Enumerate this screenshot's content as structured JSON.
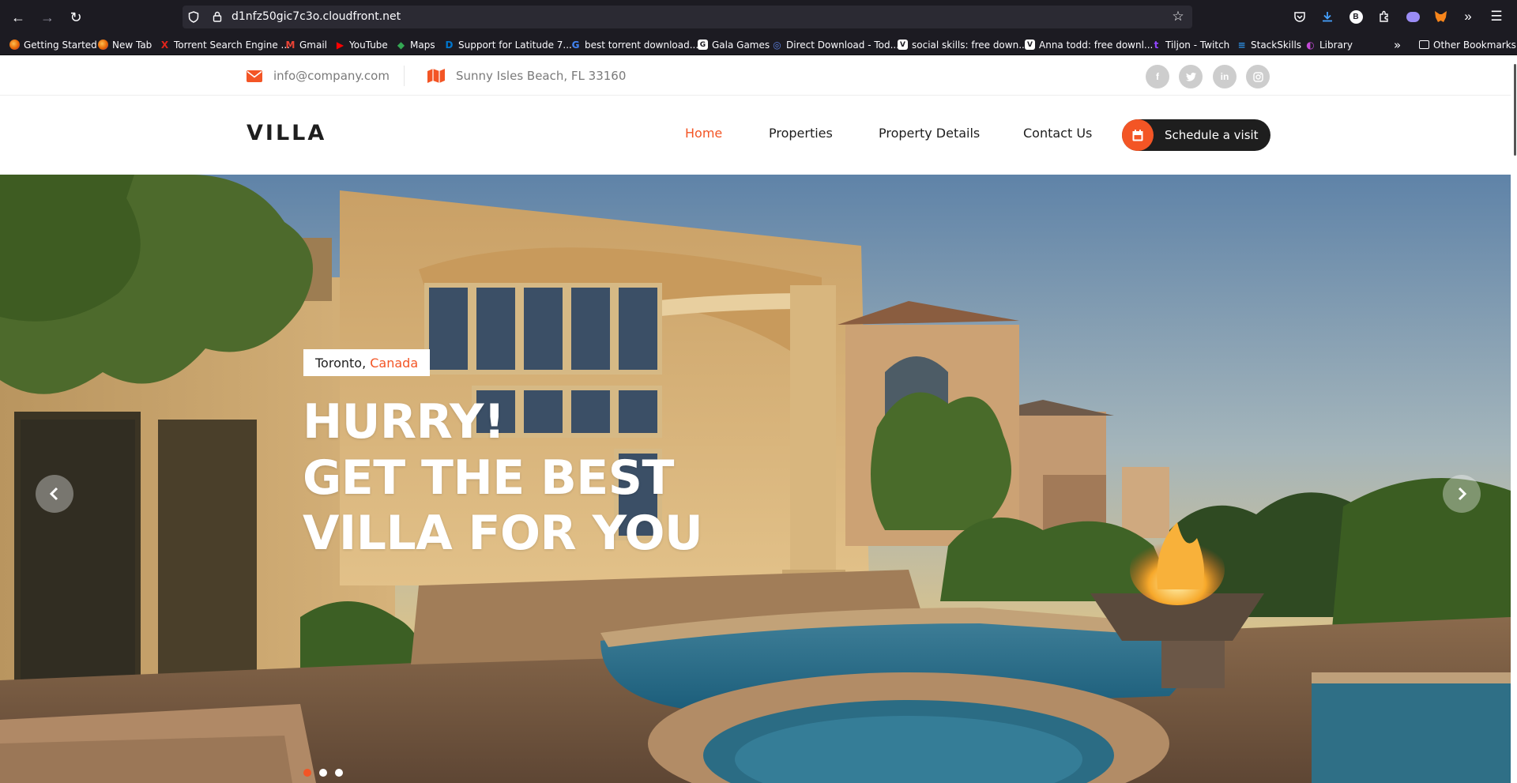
{
  "browser": {
    "url": "d1nfz50gic7c3o.cloudfront.net",
    "bookmarks": [
      {
        "label": "Getting Started",
        "icon": "firefox-icon",
        "color": "#e66000"
      },
      {
        "label": "New Tab",
        "icon": "firefox-icon",
        "color": "#e66000"
      },
      {
        "label": "Torrent Search Engine ...",
        "icon": "x-icon",
        "color": "#e0241b"
      },
      {
        "label": "Gmail",
        "icon": "gmail-icon",
        "color": "#ea4335"
      },
      {
        "label": "YouTube",
        "icon": "youtube-icon",
        "color": "#ff0000"
      },
      {
        "label": "Maps",
        "icon": "maps-icon",
        "color": "#34a853"
      },
      {
        "label": "Support for Latitude 7...",
        "icon": "dell-icon",
        "color": "#0076ce"
      },
      {
        "label": "best torrent download...",
        "icon": "google-icon",
        "color": "#4285f4"
      },
      {
        "label": "Gala Games",
        "icon": "gala-icon",
        "color": "#ffffff"
      },
      {
        "label": "Direct Download - Tod...",
        "icon": "globe-icon",
        "color": "#5b7fde"
      },
      {
        "label": "social skills: free down...",
        "icon": "v-icon",
        "color": "#ffffff"
      },
      {
        "label": "Anna todd: free downl...",
        "icon": "v-icon",
        "color": "#ffffff"
      },
      {
        "label": "Tiljon - Twitch",
        "icon": "twitch-icon",
        "color": "#9146ff"
      },
      {
        "label": "StackSkills",
        "icon": "stackskills-icon",
        "color": "#2c8de0"
      },
      {
        "label": "Library",
        "icon": "library-icon",
        "color": "#c34ad6"
      }
    ],
    "other_bookmarks": "Other Bookmarks"
  },
  "topbar": {
    "email": "info@company.com",
    "address": "Sunny Isles Beach, FL 33160",
    "socials": [
      "facebook-icon",
      "twitter-icon",
      "linkedin-icon",
      "instagram-icon"
    ]
  },
  "header": {
    "logo": "VILLA",
    "nav": [
      "Home",
      "Properties",
      "Property Details",
      "Contact Us"
    ],
    "active_nav": "Home",
    "cta": "Schedule a visit"
  },
  "hero": {
    "city": "Toronto,",
    "country": "Canada",
    "headline": [
      "HURRY!",
      "GET THE BEST",
      "VILLA FOR YOU"
    ],
    "slides": 3,
    "active_slide": 1
  },
  "colors": {
    "accent": "#f35525",
    "dark": "#1e1e1e"
  }
}
